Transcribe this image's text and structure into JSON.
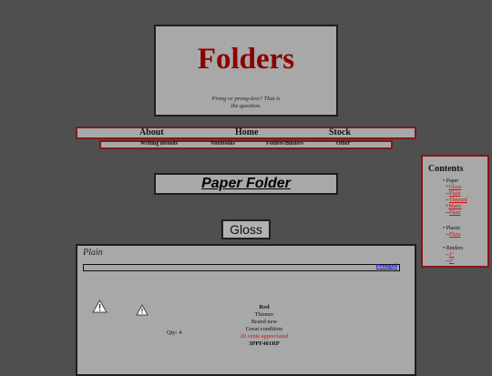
{
  "header": {
    "title": "Folders",
    "tagline_line1": "Prong or prong-less? That is",
    "tagline_line2": "the question."
  },
  "nav": {
    "main": [
      "About",
      "Home",
      "Stock"
    ],
    "sub": [
      "Writing utensils",
      "Notebooks",
      "Folders/Binders",
      "Other"
    ]
  },
  "section": {
    "title": "Paper Folder",
    "subtitle": "Gloss"
  },
  "product": {
    "heading": "Plain",
    "bar_link": "Pronged",
    "qty": "Qty: 4",
    "dot": ".",
    "details": {
      "color": "Red",
      "thickness": "Thinner",
      "condition1": "Brand new",
      "condition2": "Great condition",
      "price": "20 cents appreciated",
      "sku": "3PPF401RP"
    },
    "icons": [
      "warning-icon",
      "warning-icon"
    ]
  },
  "contents": {
    "title": "Contents",
    "groups": [
      {
        "label": "Paper",
        "items": [
          {
            "prefix": "+",
            "text": "Gloss"
          },
          {
            "prefix": "--",
            "text": "Plain"
          },
          {
            "prefix": "--",
            "text": "Themed"
          },
          {
            "prefix": "+",
            "text": "Matte"
          },
          {
            "prefix": "--",
            "text": "Plain"
          }
        ]
      },
      {
        "label": "Plastic",
        "items": [
          {
            "prefix": "--",
            "text": "Plain"
          }
        ]
      },
      {
        "label": "Binders",
        "items": [
          {
            "prefix": "--",
            "text": "1\""
          },
          {
            "prefix": "--",
            "text": "2\""
          }
        ]
      }
    ]
  },
  "colors": {
    "background": "#4f4f4f",
    "panel": "#a8a8a8",
    "title_red": "#8b0000",
    "link_red": "#d01010",
    "link_blue": "#1a1adb"
  }
}
